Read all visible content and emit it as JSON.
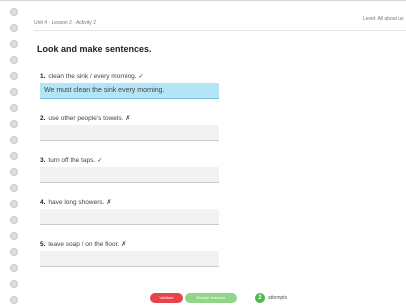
{
  "header": {
    "breadcrumb": "Unit 4 · Lesson 2 · Activity 2",
    "right_text": "Level: All about us"
  },
  "title": "Look and make sentences.",
  "questions": [
    {
      "number": "1.",
      "prompt": "clean the sink / every morning. ✓",
      "answer": "We must clean the sink every morning."
    },
    {
      "number": "2.",
      "prompt": "use other people's towels. ✗",
      "answer": ""
    },
    {
      "number": "3.",
      "prompt": "turn off the taps. ✓",
      "answer": ""
    },
    {
      "number": "4.",
      "prompt": "have long showers. ✗",
      "answer": ""
    },
    {
      "number": "5.",
      "prompt": "leave soap / on the floor. ✗",
      "answer": ""
    }
  ],
  "footer": {
    "validate_label": "Validate",
    "restart_label": "Restart exercise",
    "attempts_count": "2",
    "attempts_label": "attempts"
  },
  "colors": {
    "filled_answer": "#b3e5f7",
    "validate": "#e8434a",
    "restart": "#8fd58a",
    "attempts": "#4cb84a"
  }
}
